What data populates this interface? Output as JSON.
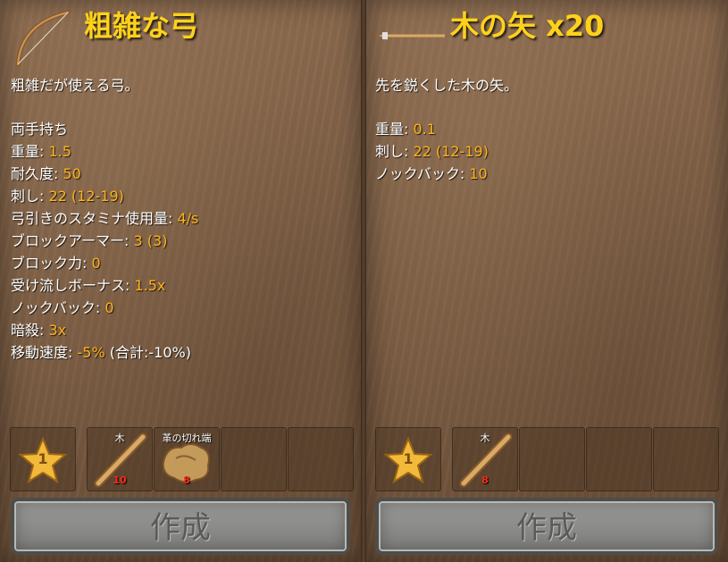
{
  "colors": {
    "title": "#ffd21a",
    "value": "#ffb21a",
    "count": "#ff2a1a",
    "text": "#ffffff"
  },
  "left": {
    "icon": "bow-icon",
    "title": "粗雑な弓",
    "description": "粗雑だが使える弓。",
    "handedness": "両手持ち",
    "stats": [
      {
        "label": "重量: ",
        "value": "1.5",
        "extra": ""
      },
      {
        "label": "耐久度: ",
        "value": "50",
        "extra": ""
      },
      {
        "label": "刺し: ",
        "value": "22 (12-19)",
        "extra": ""
      },
      {
        "label": "弓引きのスタミナ使用量: ",
        "value": "4/s",
        "extra": ""
      },
      {
        "label": "ブロックアーマー: ",
        "value": "3 (3)",
        "extra": ""
      },
      {
        "label": "ブロック力: ",
        "value": "0",
        "extra": ""
      },
      {
        "label": "受け流しボーナス: ",
        "value": "1.5x",
        "extra": ""
      },
      {
        "label": "ノックバック: ",
        "value": "0",
        "extra": ""
      },
      {
        "label": "暗殺: ",
        "value": "3x",
        "extra": ""
      },
      {
        "label": "移動速度: ",
        "value": "-5%",
        "extra": " (合計:-10%)"
      }
    ],
    "quality": "1",
    "materials": [
      {
        "name": "木",
        "count": "10",
        "icon": "wood-icon"
      },
      {
        "name": "革の切れ端",
        "count": "8",
        "icon": "leather-scraps-icon"
      }
    ],
    "craft_label": "作成"
  },
  "right": {
    "icon": "arrow-icon",
    "title": "木の矢 x20",
    "description": "先を鋭くした木の矢。",
    "stats": [
      {
        "label": "重量: ",
        "value": "0.1"
      },
      {
        "label": "刺し: ",
        "value": "22 (12-19)"
      },
      {
        "label": "ノックバック: ",
        "value": "10"
      }
    ],
    "quality": "1",
    "materials": [
      {
        "name": "木",
        "count": "8",
        "icon": "wood-icon"
      }
    ],
    "craft_label": "作成"
  }
}
